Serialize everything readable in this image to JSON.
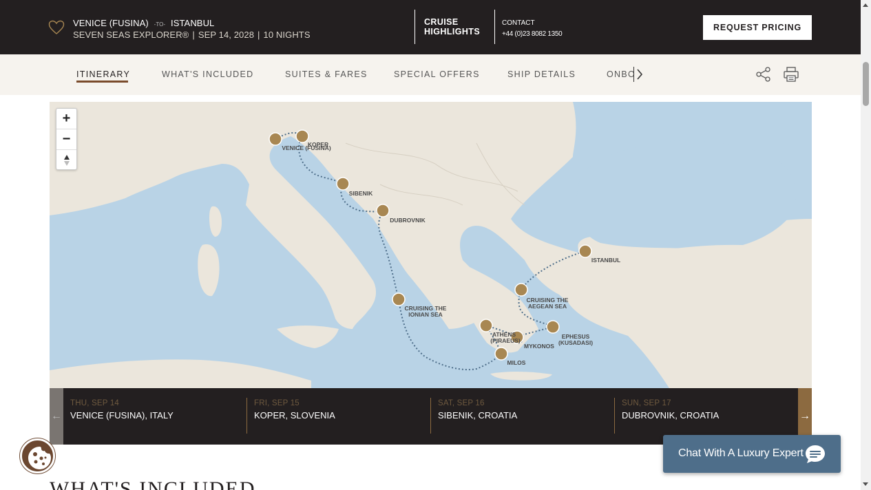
{
  "header": {
    "departure": "VENICE (FUSINA)",
    "to_word": "-TO-",
    "arrival": "ISTANBUL",
    "ship": "SEVEN SEAS EXPLORER®",
    "date": "SEP 14, 2028",
    "nights": "10 NIGHTS",
    "highlights_line1": "CRUISE",
    "highlights_line2": "HIGHLIGHTS",
    "contact_label": "CONTACT",
    "contact_phone": "+44 (0)23 8082 1350",
    "request_button": "REQUEST PRICING"
  },
  "nav": {
    "items": [
      {
        "label": "ITINERARY",
        "active": true
      },
      {
        "label": "WHAT'S INCLUDED"
      },
      {
        "label": "SUITES & FARES"
      },
      {
        "label": "SPECIAL OFFERS"
      },
      {
        "label": "SHIP DETAILS"
      },
      {
        "label": "ONBOARD"
      }
    ]
  },
  "map": {
    "zoom_in": "+",
    "zoom_out": "−",
    "ports": [
      {
        "label": "VENICE (FUSINA)"
      },
      {
        "label": "KOPER"
      },
      {
        "label": "SIBENIK"
      },
      {
        "label": "DUBROVNIK"
      },
      {
        "label": "CRUISING THE",
        "label2": "IONIAN SEA"
      },
      {
        "label": "ATHENS",
        "label2": "(PIRAEUS)"
      },
      {
        "label": "MILOS"
      },
      {
        "label": "MYKONOS"
      },
      {
        "label": "EPHESUS",
        "label2": "(KUSADASI)"
      },
      {
        "label": "CRUISING THE",
        "label2": "AEGEAN SEA"
      },
      {
        "label": "ISTANBUL"
      }
    ]
  },
  "itinerary": {
    "prev": "←",
    "next": "→",
    "days": [
      {
        "date": "THU, SEP 14",
        "port": "VENICE (FUSINA), ITALY"
      },
      {
        "date": "FRI, SEP 15",
        "port": "KOPER, SLOVENIA"
      },
      {
        "date": "SAT, SEP 16",
        "port": "SIBENIK, CROATIA"
      },
      {
        "date": "SUN, SEP 17",
        "port": "DUBROVNIK, CROATIA"
      }
    ]
  },
  "chat": {
    "label": "Chat With A Luxury Expert"
  },
  "section": {
    "title": "WHAT'S INCLUDED"
  },
  "colors": {
    "header_bg": "#231f20",
    "nav_bg": "#f6f3ee",
    "accent_brown": "#7a4b2b",
    "port_marker": "#a88752",
    "chat_bg": "#4e6e8a",
    "sea": "#b9d3e6",
    "land": "#ebe6dc"
  }
}
